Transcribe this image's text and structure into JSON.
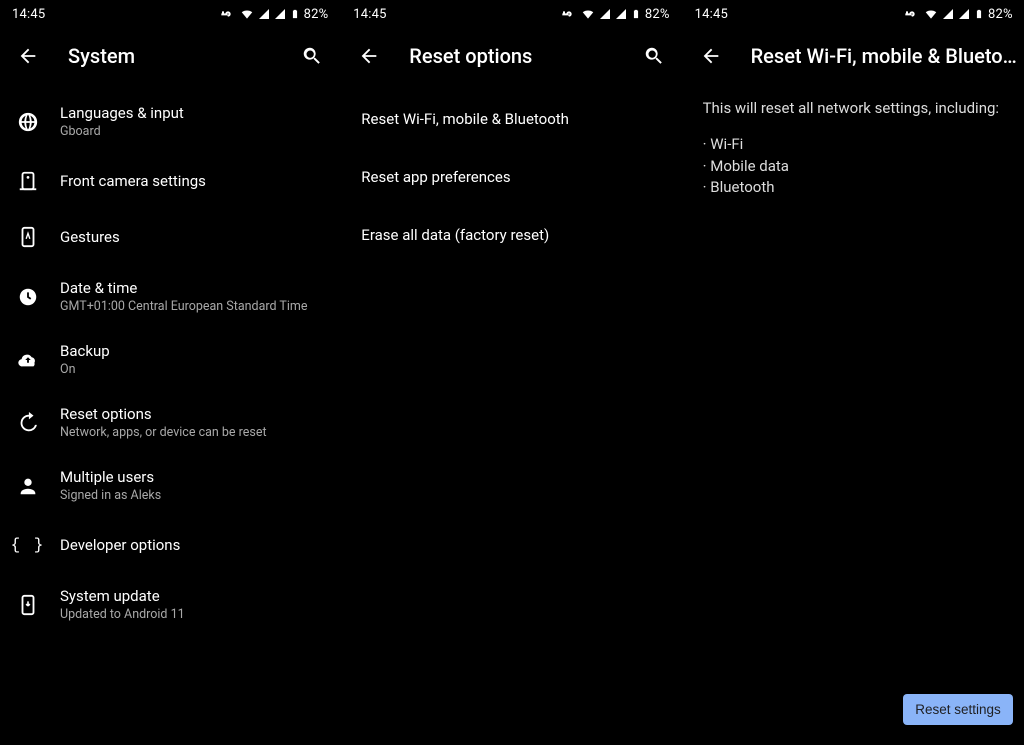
{
  "status": {
    "time": "14:45",
    "battery_pct": "82%"
  },
  "pane1": {
    "title": "System",
    "items": [
      {
        "title": "Languages & input",
        "sub": "Gboard"
      },
      {
        "title": "Front camera settings",
        "sub": ""
      },
      {
        "title": "Gestures",
        "sub": ""
      },
      {
        "title": "Date & time",
        "sub": "GMT+01:00 Central European Standard Time"
      },
      {
        "title": "Backup",
        "sub": "On"
      },
      {
        "title": "Reset options",
        "sub": "Network, apps, or device can be reset"
      },
      {
        "title": "Multiple users",
        "sub": "Signed in as Aleks"
      },
      {
        "title": "Developer options",
        "sub": ""
      },
      {
        "title": "System update",
        "sub": "Updated to Android 11"
      }
    ]
  },
  "pane2": {
    "title": "Reset options",
    "items": [
      "Reset Wi-Fi, mobile & Bluetooth",
      "Reset app preferences",
      "Erase all data (factory reset)"
    ]
  },
  "pane3": {
    "title": "Reset Wi-Fi, mobile & Blueto…",
    "intro": "This will reset all network settings, including:",
    "bullets": [
      "Wi-Fi",
      "Mobile data",
      "Bluetooth"
    ],
    "button": "Reset settings"
  }
}
